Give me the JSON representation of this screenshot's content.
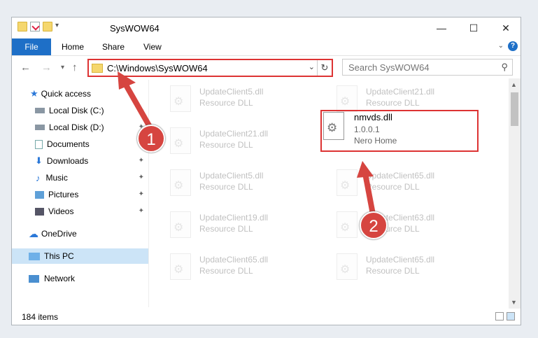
{
  "window": {
    "title": "SysWOW64",
    "minimize": "—",
    "maximize": "☐",
    "close": "✕"
  },
  "ribbon": {
    "file": "File",
    "tabs": [
      "Home",
      "Share",
      "View"
    ],
    "help": "?"
  },
  "nav": {
    "back": "←",
    "forward": "→",
    "recent": "▾",
    "up": "↑",
    "address": "C:\\Windows\\SysWOW64",
    "search_placeholder": "Search SysWOW64"
  },
  "sidebar": {
    "items": [
      {
        "label": "Quick access",
        "icon": "star-icon"
      },
      {
        "label": "Local Disk (C:)",
        "icon": "disk-icon"
      },
      {
        "label": "Local Disk (D:)",
        "icon": "disk-icon"
      },
      {
        "label": "Documents",
        "icon": "documents-icon"
      },
      {
        "label": "Downloads",
        "icon": "download-icon"
      },
      {
        "label": "Music",
        "icon": "music-icon"
      },
      {
        "label": "Pictures",
        "icon": "pictures-icon"
      },
      {
        "label": "Videos",
        "icon": "videos-icon"
      },
      {
        "label": "OneDrive",
        "icon": "cloud-icon"
      },
      {
        "label": "This PC",
        "icon": "computer-icon"
      },
      {
        "label": "Network",
        "icon": "network-icon"
      }
    ]
  },
  "files": [
    {
      "name": "UpdateClient5.dll",
      "type": "Resource DLL"
    },
    {
      "name": "UpdateClient21.dll",
      "type": "Resource DLL"
    },
    {
      "name": "UpdateClient21.dll",
      "type": "Resource DLL"
    },
    {
      "name": "UpdateClient5.dll",
      "type": "Resource DLL"
    },
    {
      "name": "UpdateClient65.dll",
      "type": "Resource DLL"
    },
    {
      "name": "UpdateClient19.dll",
      "type": "Resource DLL"
    },
    {
      "name": "UpdateClient63.dll",
      "type": "Resource DLL"
    },
    {
      "name": "UpdateClient65.dll",
      "type": "Resource DLL"
    },
    {
      "name": "UpdateClient65.dll",
      "type": "Resource DLL"
    }
  ],
  "highlighted_file": {
    "name": "nmvds.dll",
    "version": "1.0.0.1",
    "company": "Nero Home"
  },
  "status": {
    "count": "184 items"
  },
  "annotations": {
    "step1": "1",
    "step2": "2",
    "color": "#d64540"
  }
}
